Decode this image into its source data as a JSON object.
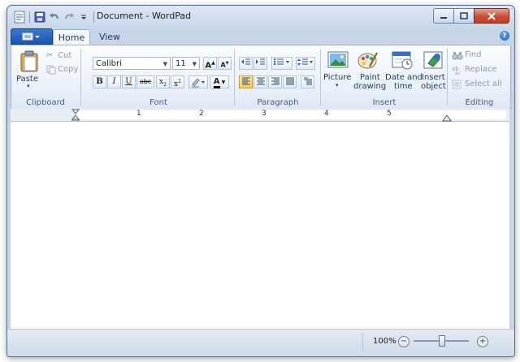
{
  "window": {
    "title": "Document - WordPad"
  },
  "quick_access": {
    "icons": [
      "wordpad-app-icon",
      "save-icon",
      "undo-icon",
      "redo-icon",
      "customize-icon"
    ]
  },
  "tabs": {
    "home": "Home",
    "view": "View"
  },
  "ribbon": {
    "clipboard": {
      "group_label": "Clipboard",
      "paste": "Paste",
      "cut": "Cut",
      "copy": "Copy"
    },
    "font": {
      "group_label": "Font",
      "family": "Calibri",
      "size": "11",
      "bold": "B",
      "italic": "I",
      "underline": "U",
      "strike": "abc",
      "grow": "A",
      "shrink": "A",
      "color_letter": "A"
    },
    "paragraph": {
      "group_label": "Paragraph"
    },
    "insert": {
      "group_label": "Insert",
      "picture": "Picture",
      "paint_line1": "Paint",
      "paint_line2": "drawing",
      "date_line1": "Date and",
      "date_line2": "time",
      "object_line1": "Insert",
      "object_line2": "object"
    },
    "editing": {
      "group_label": "Editing",
      "find": "Find",
      "replace": "Replace",
      "select_all": "Select all"
    }
  },
  "ruler": {
    "numbers": [
      "1",
      "2",
      "3",
      "4",
      "5"
    ]
  },
  "status": {
    "zoom": "100%",
    "zoom_fraction": 0.5
  },
  "colors": {
    "accent": "#1c54b0",
    "close": "#c84e35",
    "chrome": "#c6d5e8"
  }
}
